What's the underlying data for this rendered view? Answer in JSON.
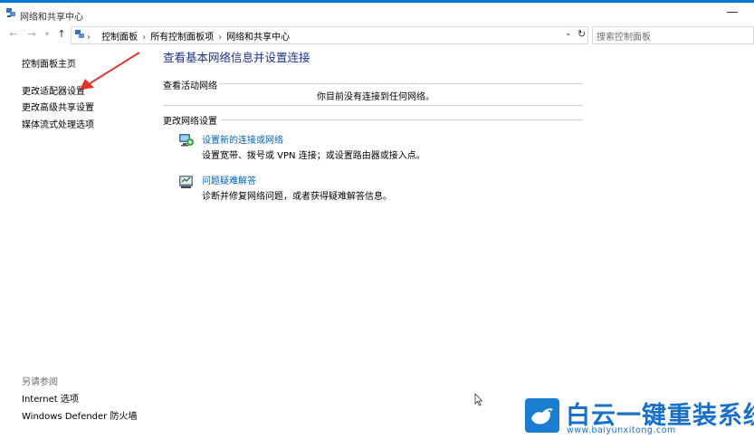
{
  "window": {
    "title": "网络和共享中心"
  },
  "address": {
    "crumbs": [
      "控制面板",
      "所有控制面板项",
      "网络和共享中心"
    ],
    "search_placeholder": "搜索控制面板"
  },
  "sidebar": {
    "items": [
      {
        "label": "控制面板主页"
      },
      {
        "label": "更改适配器设置"
      },
      {
        "label": "更改高级共享设置"
      },
      {
        "label": "媒体流式处理选项"
      }
    ],
    "see_also_label": "另请参阅",
    "see_also": [
      {
        "label": "Internet 选项"
      },
      {
        "label": "Windows Defender 防火墙"
      }
    ]
  },
  "main": {
    "title": "查看基本网络信息并设置连接",
    "active_networks_label": "查看活动网络",
    "no_connection_msg": "你目前没有连接到任何网络。",
    "change_settings_label": "更改网络设置",
    "tasks": [
      {
        "link": "设置新的连接或网络",
        "desc": "设置宽带、拨号或 VPN 连接；或设置路由器或接入点。",
        "icon": "new-connection-icon"
      },
      {
        "link": "问题疑难解答",
        "desc": "诊断并修复网络问题，或者获得疑难解答信息。",
        "icon": "troubleshoot-icon"
      }
    ]
  },
  "watermark": {
    "brand": "白云一键重装系统",
    "url": "www.baiyunxitong.com"
  },
  "colors": {
    "accent": "#0078d7",
    "link": "#0063b1",
    "title": "#1e3287",
    "annotation_arrow": "#e0352b"
  }
}
